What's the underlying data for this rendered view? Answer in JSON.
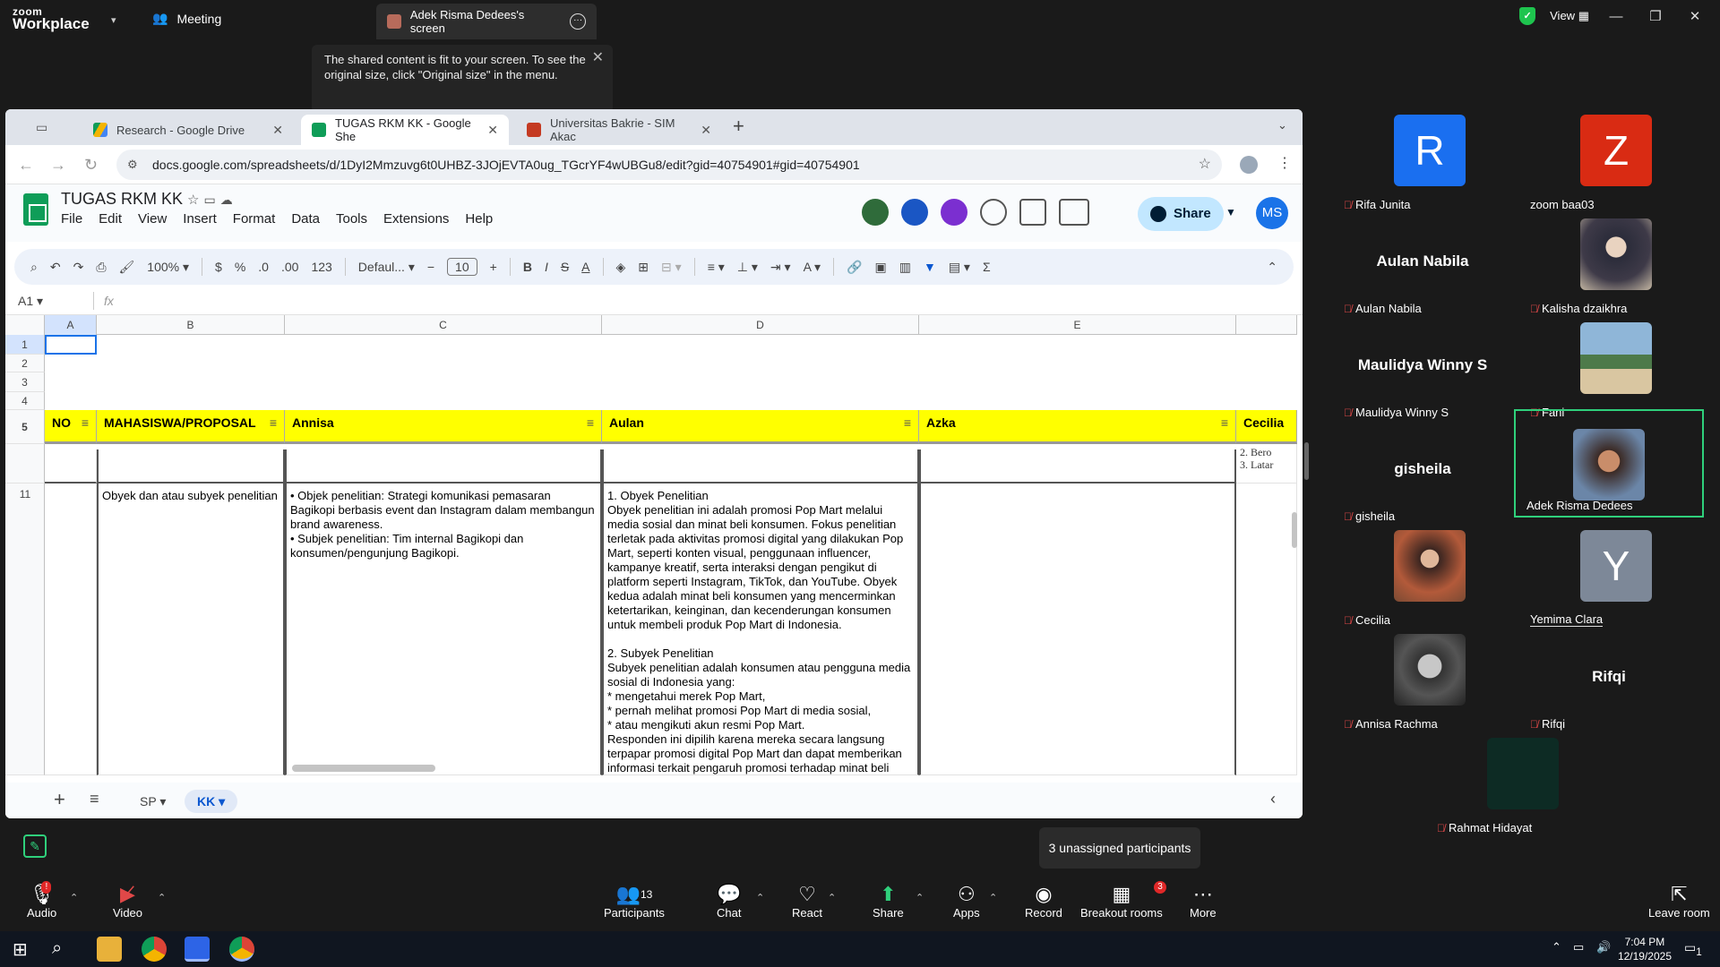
{
  "zoom": {
    "logo_top": "zoom",
    "logo_bottom": "Workplace",
    "meeting_label": "Meeting",
    "screen_tab": "Adek Risma Dedees's screen",
    "tooltip": "The shared content is fit to your screen. To see the original size, click \"Original size\" in the menu.",
    "view_label": "View",
    "unassigned_tooltip": "3 unassigned participants",
    "participant_count": "13",
    "breakout_badge": "3",
    "controls": {
      "audio": "Audio",
      "video": "Video",
      "participants": "Participants",
      "chat": "Chat",
      "react": "React",
      "share": "Share",
      "apps": "Apps",
      "record": "Record",
      "breakout": "Breakout rooms",
      "more": "More",
      "leave": "Leave room"
    }
  },
  "browser": {
    "tabs": [
      {
        "label": "Research - Google Drive"
      },
      {
        "label": "TUGAS RKM KK - Google She"
      },
      {
        "label": "Universitas Bakrie - SIM Akac"
      }
    ],
    "url": "docs.google.com/spreadsheets/d/1DyI2Mmzuvg6t0UHBZ-3JOjEVTA0ug_TGcrYF4wUBGu8/edit?gid=40754901#gid=40754901"
  },
  "sheets": {
    "title": "TUGAS RKM KK",
    "menus": [
      "File",
      "Edit",
      "View",
      "Insert",
      "Format",
      "Data",
      "Tools",
      "Extensions",
      "Help"
    ],
    "share": "Share",
    "avatar": "MS",
    "zoom": "100%",
    "currency": "$",
    "percent": "%",
    "dec_dec": ".0",
    "dec_inc": ".00",
    "num_fmt": "123",
    "font": "Defaul...",
    "font_size": "10",
    "cell_ref": "A1",
    "fx": "fx",
    "columns": [
      "A",
      "B",
      "C",
      "D",
      "E"
    ],
    "rows": [
      "1",
      "2",
      "3",
      "4",
      "5",
      "11"
    ],
    "headers": {
      "a": "NO",
      "b": "MAHASISWA/PROPOSAL",
      "c": "Annisa",
      "d": "Aulan",
      "e": "Azka",
      "f": "Cecilia"
    },
    "row11": {
      "no": "11",
      "b": "Obyek dan atau subyek penelitian",
      "c": "•     Objek penelitian: Strategi komunikasi pemasaran Bagikopi berbasis event dan Instagram dalam membangun brand awareness.\n•     Subjek penelitian: Tim internal Bagikopi dan konsumen/pengunjung Bagikopi.",
      "d": "1. Obyek Penelitian\nObyek penelitian ini adalah promosi Pop Mart melalui media sosial dan minat beli konsumen. Fokus penelitian terletak pada aktivitas promosi digital yang dilakukan Pop Mart, seperti konten visual, penggunaan influencer, kampanye kreatif, serta interaksi dengan pengikut di platform seperti Instagram, TikTok, dan YouTube. Obyek kedua adalah minat beli konsumen yang mencerminkan ketertarikan, keinginan, dan kecenderungan konsumen untuk membeli produk Pop Mart di Indonesia.\n\n2. Subyek Penelitian\nSubyek penelitian adalah konsumen atau pengguna media sosial di Indonesia yang:\n* mengetahui merek Pop Mart,\n* pernah melihat promosi Pop Mart di media sosial,\n* atau mengikuti akun resmi Pop Mart.\nResponden ini dipilih karena mereka secara langsung terpapar promosi digital Pop Mart dan dapat memberikan informasi terkait pengaruh promosi terhadap minat beli",
      "f_partial": "2.   Bero\n3.   Latar"
    },
    "sheet_tabs": [
      "SP",
      "KK"
    ]
  },
  "participants": [
    {
      "name": "Rifa Junita",
      "initial": "R",
      "color": "#1a6ff0",
      "muted": true
    },
    {
      "name": "zoom baa03",
      "initial": "Z",
      "color": "#d92b13",
      "muted": false
    },
    {
      "name": "Aulan Nabila",
      "display": "Aulan Nabila",
      "muted": true
    },
    {
      "name": "Kalisha dzaikhra",
      "muted": true
    },
    {
      "name": "Maulidya Winny S",
      "display": "Maulidya Winny S",
      "muted": true
    },
    {
      "name": "Fani",
      "muted": true
    },
    {
      "name": "gisheila",
      "display": "gisheila",
      "muted": true
    },
    {
      "name": "Adek Risma Dedees",
      "muted": false
    },
    {
      "name": "Cecilia",
      "muted": true
    },
    {
      "name": "Yemima Clara",
      "initial": "Y",
      "color": "#7d8898",
      "muted": false
    },
    {
      "name": "Annisa Rachma",
      "muted": true
    },
    {
      "name": "Rifqi",
      "display": "Rifqi",
      "muted": true
    },
    {
      "name": "Rahmat Hidayat",
      "muted": true
    }
  ],
  "taskbar": {
    "time": "7:04 PM",
    "date": "12/19/2025",
    "notif_count": "1"
  }
}
